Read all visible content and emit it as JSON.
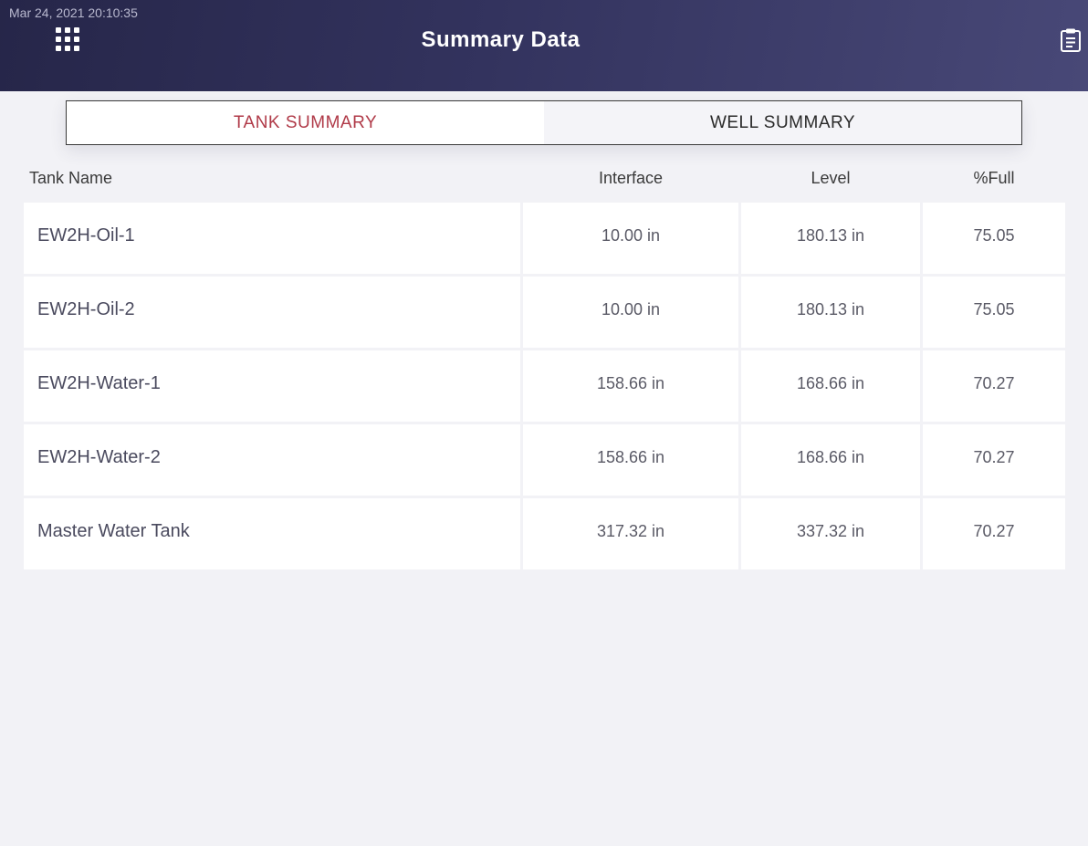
{
  "header": {
    "timestamp": "Mar 24, 2021 20:10:35",
    "title": "Summary Data",
    "apps_icon": "grid-icon",
    "clipboard_icon": "clipboard-icon",
    "gradient_start": "#262649",
    "gradient_end": "#484877"
  },
  "tabs": [
    {
      "label": "TANK SUMMARY",
      "active": true
    },
    {
      "label": "WELL SUMMARY",
      "active": false
    }
  ],
  "accent_color": "#b03a48",
  "table": {
    "columns": [
      "Tank Name",
      "Interface",
      "Level",
      "%Full"
    ],
    "rows": [
      {
        "name": "EW2H-Oil-1",
        "interface": "10.00 in",
        "level": "180.13 in",
        "full": "75.05"
      },
      {
        "name": "EW2H-Oil-2",
        "interface": "10.00 in",
        "level": "180.13 in",
        "full": "75.05"
      },
      {
        "name": "EW2H-Water-1",
        "interface": "158.66 in",
        "level": "168.66 in",
        "full": "70.27"
      },
      {
        "name": "EW2H-Water-2",
        "interface": "158.66 in",
        "level": "168.66 in",
        "full": "70.27"
      },
      {
        "name": "Master Water Tank",
        "interface": "317.32 in",
        "level": "337.32 in",
        "full": "70.27"
      }
    ]
  }
}
